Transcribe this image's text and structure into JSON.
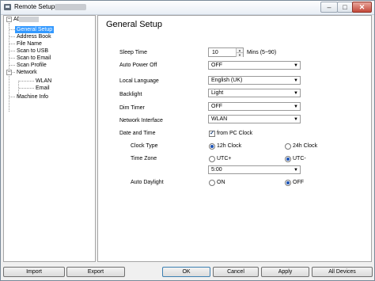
{
  "window": {
    "title": "Remote Setup -",
    "min": "–",
    "max": "□",
    "close": "✕"
  },
  "tree": {
    "root": "ADS",
    "items": [
      "General Setup",
      "Address Book",
      "File Name",
      "Scan to USB",
      "Scan to Email",
      "Scan Profile"
    ],
    "network": "Network",
    "network_children": [
      "WLAN",
      "Email"
    ],
    "machine_info": "Machine Info",
    "expand_symbol": "−"
  },
  "panel": {
    "title": "General Setup",
    "sleep_time": {
      "label": "Sleep Time",
      "value": "10",
      "unit": "Mins (5~90)"
    },
    "auto_power_off": {
      "label": "Auto Power Off",
      "value": "OFF"
    },
    "local_language": {
      "label": "Local Language",
      "value": "English (UK)"
    },
    "backlight": {
      "label": "Backlight",
      "value": "Light"
    },
    "dim_timer": {
      "label": "Dim Timer",
      "value": "OFF"
    },
    "network_interface": {
      "label": "Network Interface",
      "value": "WLAN"
    },
    "date_time": {
      "label": "Date and Time",
      "checkbox": "from PC Clock",
      "checked_mark": "✓"
    },
    "clock_type": {
      "label": "Clock Type",
      "opt1": "12h Clock",
      "opt2": "24h Clock",
      "selected": "12h Clock"
    },
    "time_zone": {
      "label": "Time Zone",
      "opt1": "UTC+",
      "opt2": "UTC-",
      "selected": "UTC-",
      "value": "5:00"
    },
    "auto_daylight": {
      "label": "Auto Daylight",
      "opt1": "ON",
      "opt2": "OFF",
      "selected": "OFF"
    },
    "dropdown_arrow": "▼",
    "spin_up": "▲",
    "spin_down": "▼"
  },
  "buttons": {
    "import": "Import",
    "export": "Export",
    "ok": "OK",
    "cancel": "Cancel",
    "apply": "Apply",
    "all_devices": "All Devices"
  }
}
